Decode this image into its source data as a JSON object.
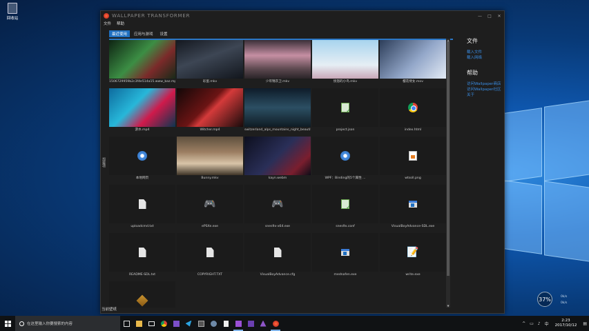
{
  "desktop": {
    "recycle_bin": "回收站"
  },
  "window": {
    "title": "WALLPAPER TRANSFORMER",
    "menu": [
      "文件",
      "帮助"
    ],
    "tabs": [
      "最近使用",
      "应用与游戏",
      "设置"
    ],
    "vertical_label": "加载项",
    "status": "当前壁纸"
  },
  "items": [
    {
      "caption": "1506729959b2c3f4e514a15.www_baz.mp4",
      "kind": "image",
      "thumb": "t0"
    },
    {
      "caption": "彩蛋.mkv",
      "kind": "image",
      "thumb": "t1"
    },
    {
      "caption": "少年锦衣卫.mkv",
      "kind": "image",
      "thumb": "t2"
    },
    {
      "caption": "愤怒的小鸟.mkv",
      "kind": "image",
      "thumb": "t3"
    },
    {
      "caption": "樱花侍女.mov",
      "kind": "image",
      "thumb": "t4"
    },
    {
      "caption": "游水.mp4",
      "kind": "image",
      "thumb": "t5"
    },
    {
      "caption": "Witcher.mp4",
      "kind": "image",
      "thumb": "t6"
    },
    {
      "caption": "switzerland_alps_mountains_night_beautiful_landscape_windy_1920x1080.mp4",
      "kind": "image",
      "thumb": "t7"
    },
    {
      "caption": "project.json",
      "kind": "json-icon"
    },
    {
      "caption": "index.html",
      "kind": "chrome-icon"
    },
    {
      "caption": "本地网页",
      "kind": "ie-icon"
    },
    {
      "caption": "Bunny.mkv",
      "kind": "image",
      "thumb": "t8"
    },
    {
      "caption": "kayn.webm",
      "kind": "image",
      "thumb": "t9"
    },
    {
      "caption": "WPF：Binding的5个属性 ...",
      "kind": "ie-icon"
    },
    {
      "caption": "wtsoll.png",
      "kind": "png-icon"
    },
    {
      "caption": "uploadcmd.txt",
      "kind": "doc-icon"
    },
    {
      "caption": "ePSXe.exe",
      "kind": "gamepad-icon"
    },
    {
      "caption": "snes9x-x64.exe",
      "kind": "gamepad-icon"
    },
    {
      "caption": "snes9x.conf",
      "kind": "json-icon"
    },
    {
      "caption": "VisualBoyAdvance-SDL.exe",
      "kind": "exe-icon"
    },
    {
      "caption": "README-SDL.txt",
      "kind": "doc-icon"
    },
    {
      "caption": "COPYRIGHT.TXT",
      "kind": "doc-icon"
    },
    {
      "caption": "VisualBoyAdvance.cfg",
      "kind": "doc-icon"
    },
    {
      "caption": "mednafen.exe",
      "kind": "exe-icon"
    },
    {
      "caption": "write.exe",
      "kind": "edit-icon"
    },
    {
      "caption": "",
      "kind": "bear-icon"
    }
  ],
  "sidebar": {
    "file_heading": "文件",
    "file_links": [
      "载入文件",
      "载入网络"
    ],
    "help_heading": "帮助",
    "help_links": [
      "访问Wallpaper商店",
      "访问Wallpaper社区",
      "关于"
    ]
  },
  "widget": {
    "percent": "37%",
    "up": "0k/s",
    "down": "0k/s"
  },
  "taskbar": {
    "search_placeholder": "在这里输入你要搜索的内容",
    "time": "2:23",
    "date": "2017/10/12"
  },
  "colors": {
    "accent": "#1f6fc0",
    "link": "#3a8ee6",
    "window_bg": "#1e1e1e"
  }
}
